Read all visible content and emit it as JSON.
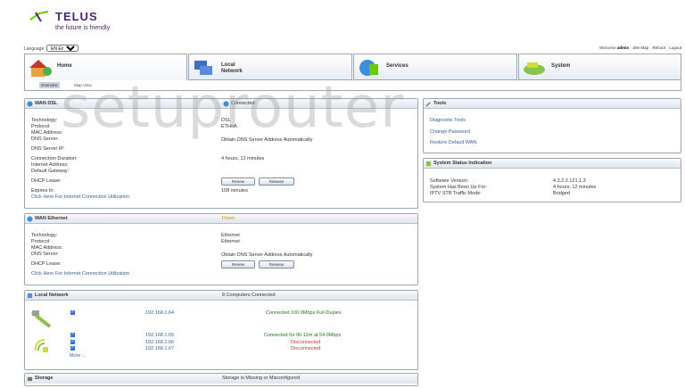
{
  "header": {
    "brand": "TELUS",
    "tagline": "the future is friendly",
    "language_label": "Language:",
    "language_value": "EN English",
    "welcome_prefix": "Welcome",
    "user": "admin",
    "links": [
      "Site Map",
      "Reboot",
      "Logout"
    ]
  },
  "tabs": [
    {
      "label": "Home"
    },
    {
      "label": "Local\nNetwork"
    },
    {
      "label": "Services"
    },
    {
      "label": "System"
    }
  ],
  "subtabs": [
    "Overview",
    "Map View"
  ],
  "watermark": "setuprouter",
  "wan_dsl": {
    "title": "WAN DSL",
    "status": "Connected",
    "labels": [
      "Technology:",
      "Protocol:",
      "MAC Address:",
      "DNS Server:",
      "DNS Server IP:",
      "Connection Duration:",
      "Internet Address:",
      "Default Gateway:",
      "DHCP Lease:",
      "Expires In:"
    ],
    "technology": "DSL",
    "protocol": "ETHoA",
    "dns_server": "Obtain DNS Server Address Automatically",
    "duration": "4 hours, 12 minutes",
    "expires": "108 minutes",
    "renew": "Renew",
    "release": "Release",
    "util_link": "Click Here For Internet Connection Utilization"
  },
  "wan_ethernet": {
    "title": "WAN Ethernet",
    "status": "Down",
    "labels": [
      "Technology:",
      "Protocol:",
      "MAC Address:",
      "DNS Server:",
      "DHCP Lease:"
    ],
    "technology": "Ethernet",
    "protocol": "Ethernet",
    "dns_server": "Obtain DNS Server Address Automatically",
    "renew": "Renew",
    "release": "Release",
    "util_link": "Click Here For Internet Connection Utilization"
  },
  "local_network": {
    "title": "Local Network",
    "summary": "8 Computers Connected",
    "wired": [
      {
        "ip": "192.168.1.64",
        "status": "Connected 100.0Mbps Full-Duplex"
      }
    ],
    "wireless": [
      {
        "ip": "192.168.1.65",
        "status": "Connected for 0h:12m at 54.0Mbps"
      },
      {
        "ip": "192.168.1.66",
        "status": "Disconnected"
      },
      {
        "ip": "192.168.1.67",
        "status": "Disconnected"
      }
    ],
    "more": "More ..."
  },
  "storage": {
    "title": "Storage",
    "status": "Storage is Missing or Misconfigured"
  },
  "tools": {
    "title": "Tools",
    "links": [
      "Diagnostic Tools",
      "Change Password",
      "Restore Default WAN"
    ]
  },
  "system_status": {
    "title": "System Status Indication",
    "labels": [
      "Software Version:",
      "System Has Been Up For:",
      "IPTV STB Traffic Mode:"
    ],
    "values": [
      "4.3.2.2.121.1.3",
      "4 hours, 12 minutes",
      "Bridged"
    ]
  }
}
